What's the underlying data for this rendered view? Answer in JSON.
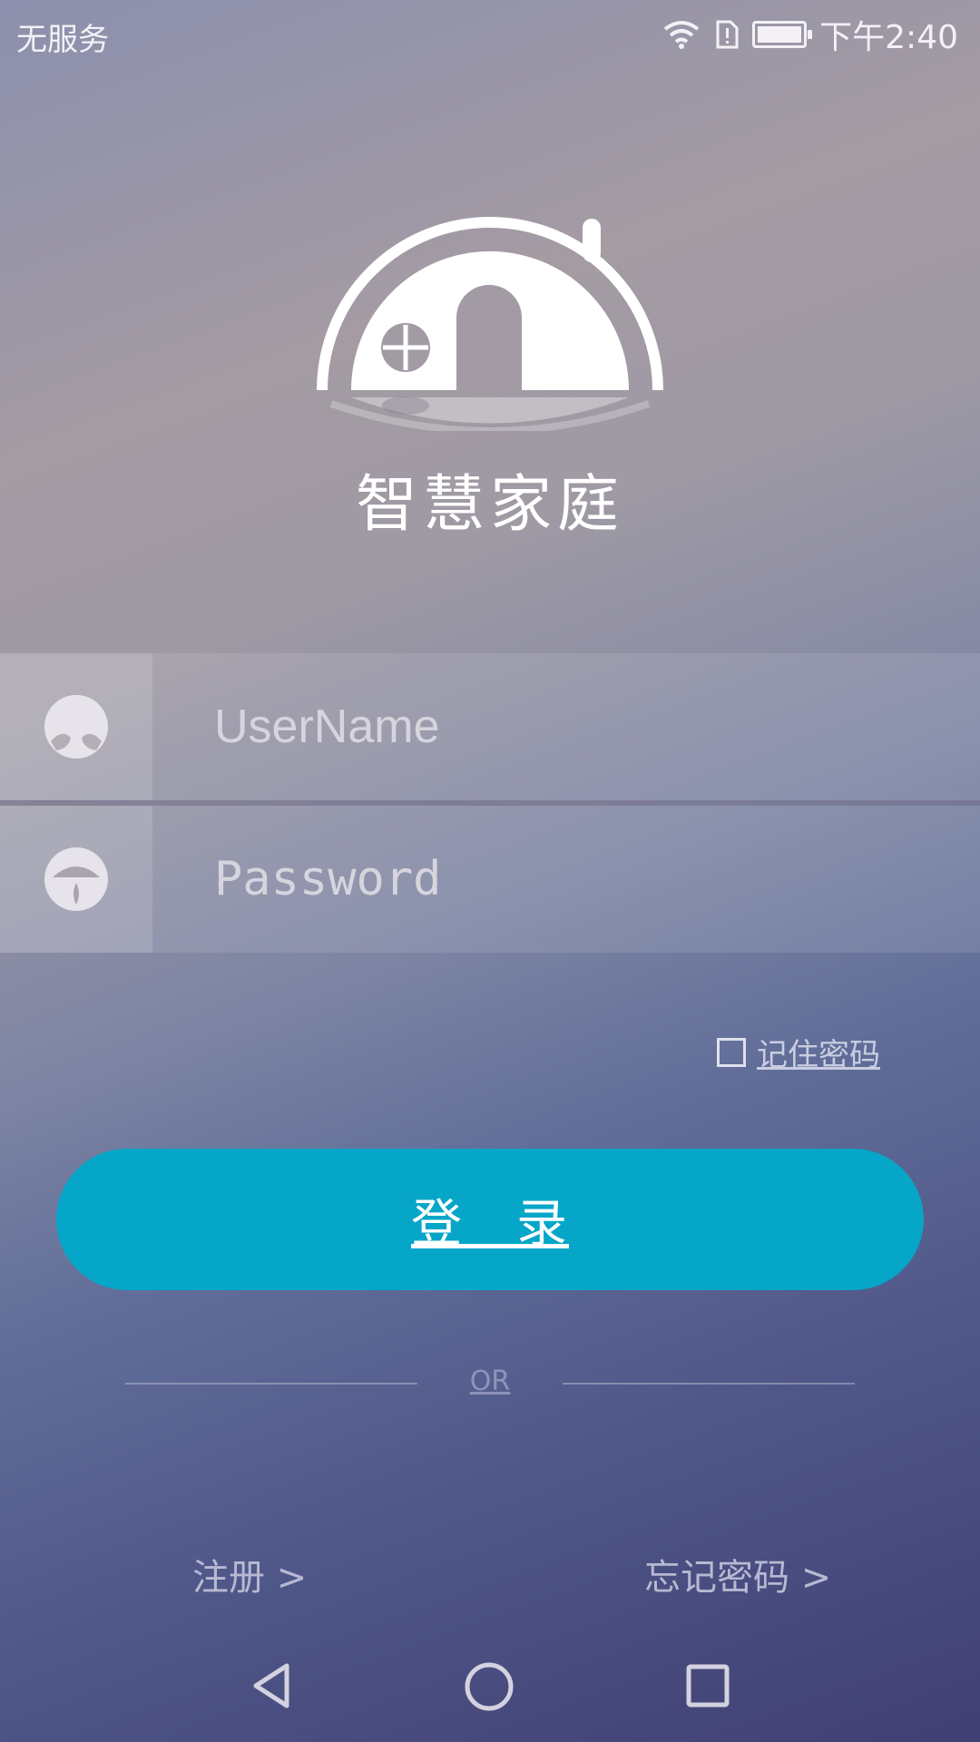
{
  "status_bar": {
    "carrier": "无服务",
    "time": "下午2:40",
    "icons": [
      "wifi-icon",
      "sim-alert-icon",
      "battery-icon"
    ]
  },
  "app": {
    "title": "智慧家庭",
    "logo_icon": "house-dome-logo"
  },
  "login_form": {
    "username": {
      "placeholder": "UserName",
      "value": "",
      "icon": "user-icon"
    },
    "password": {
      "placeholder": "Password",
      "value": "",
      "icon": "lock-icon"
    },
    "remember": {
      "label": "记住密码",
      "checked": false
    },
    "login_label": "登　录",
    "or_label": "OR"
  },
  "links": {
    "register": "注册 >",
    "forgot": "忘记密码 >"
  },
  "colors": {
    "login_button": "#06a6c8",
    "text_light": "#ffffff"
  }
}
